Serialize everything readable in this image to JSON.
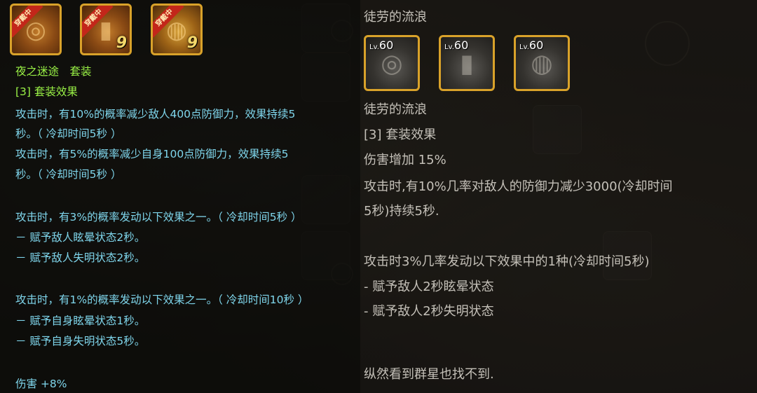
{
  "left": {
    "set_icons": [
      {
        "icon": "compass-helmet-icon",
        "ribbon": "穿戴中",
        "count": ""
      },
      {
        "icon": "gauntlet-icon",
        "ribbon": "穿戴中",
        "count": "9"
      },
      {
        "icon": "boots-icon",
        "ribbon": "穿戴中",
        "count": "9"
      }
    ],
    "set_name": "夜之迷途　套装",
    "set_header": "[3] 套装效果",
    "lines": [
      "攻击时，有10%的概率减少敌人400点防御力，效果持续5",
      "秒。（ 冷却时间5秒 ）",
      "攻击时，有5%的概率减少自身100点防御力，效果持续5",
      "秒。（ 冷却时间5秒 ）",
      "攻击时，有3%的概率发动以下效果之一。（ 冷却时间5秒 ）",
      "－ 赋予敌人眩晕状态2秒。",
      "－ 赋予敌人失明状态2秒。",
      "攻击时，有1%的概率发动以下效果之一。（ 冷却时间10秒 ）",
      "－ 赋予自身眩晕状态1秒。",
      "－ 赋予自身失明状态5秒。",
      "伤害 +8%"
    ]
  },
  "right": {
    "title": "徒劳的流浪",
    "gear": [
      {
        "icon": "compass-helmet-icon",
        "lv_prefix": "Lv.",
        "lv": "60"
      },
      {
        "icon": "gauntlet-icon",
        "lv_prefix": "Lv.",
        "lv": "60"
      },
      {
        "icon": "boots-icon",
        "lv_prefix": "Lv.",
        "lv": "60"
      }
    ],
    "set_name": "徒劳的流浪",
    "set_header": "[3] 套装效果",
    "lines": [
      "伤害增加 15%",
      "攻击时,有10%几率对敌人的防御力减少3000(冷却时间",
      "5秒)持续5秒.",
      "攻击时3%几率发动以下效果中的1种(冷却时间5秒)",
      "- 赋予敌人2秒眩晕状态",
      "- 赋予敌人2秒失明状态"
    ],
    "flavor": "纵然看到群星也找不到."
  },
  "colors": {
    "left_text": "#7fd6ec",
    "left_accent": "#9af246",
    "right_text": "#c4c0b8",
    "icon_border": "#d9a22a",
    "ribbon": "#c3261a"
  }
}
